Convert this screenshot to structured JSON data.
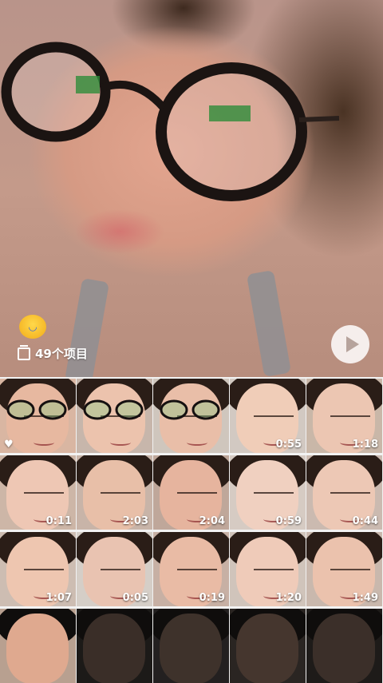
{
  "album": {
    "emoji_icon": "loudly-crying-face-emoji",
    "item_count_label": "49个项目",
    "play_icon": "play-icon"
  },
  "grid": {
    "tiles": [
      {
        "duration": "",
        "favorite": true,
        "glasses": true
      },
      {
        "duration": "",
        "favorite": false,
        "glasses": true
      },
      {
        "duration": "",
        "favorite": false,
        "glasses": true
      },
      {
        "duration": "0:55",
        "favorite": false,
        "glasses": false
      },
      {
        "duration": "1:18",
        "favorite": false,
        "glasses": false
      },
      {
        "duration": "0:11",
        "favorite": false,
        "glasses": false
      },
      {
        "duration": "2:03",
        "favorite": false,
        "glasses": false
      },
      {
        "duration": "2:04",
        "favorite": false,
        "glasses": false
      },
      {
        "duration": "0:59",
        "favorite": false,
        "glasses": false
      },
      {
        "duration": "0:44",
        "favorite": false,
        "glasses": false
      },
      {
        "duration": "1:07",
        "favorite": false,
        "glasses": false
      },
      {
        "duration": "0:05",
        "favorite": false,
        "glasses": false
      },
      {
        "duration": "0:19",
        "favorite": false,
        "glasses": false
      },
      {
        "duration": "1:20",
        "favorite": false,
        "glasses": false
      },
      {
        "duration": "1:49",
        "favorite": false,
        "glasses": false
      },
      {
        "duration": "",
        "favorite": false,
        "glasses": false
      },
      {
        "duration": "",
        "favorite": false,
        "glasses": false
      },
      {
        "duration": "",
        "favorite": false,
        "glasses": false
      },
      {
        "duration": "",
        "favorite": false,
        "glasses": false
      },
      {
        "duration": "",
        "favorite": false,
        "glasses": false
      }
    ]
  },
  "icons": {
    "favorite": "heart-icon",
    "stack": "stack-icon"
  },
  "colors": {
    "overlay_text": "#ffffff"
  }
}
